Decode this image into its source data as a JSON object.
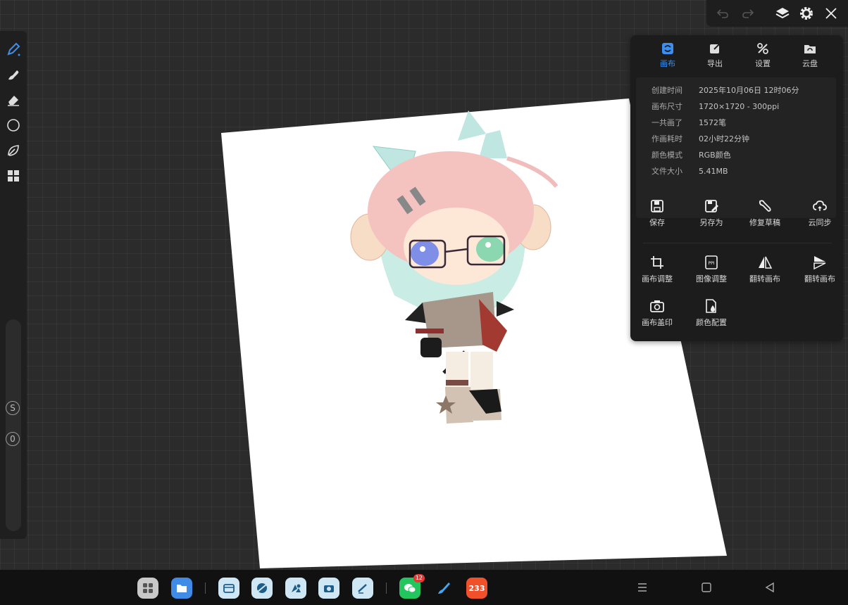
{
  "top_controls": {
    "undo_icon": "undo-icon",
    "redo_icon": "redo-icon",
    "layers_icon": "layers-icon",
    "settings_icon": "gear-icon",
    "close_icon": "close-icon"
  },
  "left_toolbar": {
    "tools": [
      "pen-icon",
      "smudge-icon",
      "eraser-icon",
      "color-circle-icon",
      "leaf-icon",
      "grid-icon"
    ],
    "size_badge": "S",
    "opacity_badge": "0"
  },
  "panel": {
    "tabs": [
      {
        "label": "画布",
        "icon": "canvas-icon",
        "active": true
      },
      {
        "label": "导出",
        "icon": "export-icon",
        "active": false
      },
      {
        "label": "设置",
        "icon": "tools-icon",
        "active": false
      },
      {
        "label": "云盘",
        "icon": "cloud-folder-icon",
        "active": false
      }
    ],
    "info": [
      {
        "key": "创建时间",
        "value": "2025年10月06日 12时06分"
      },
      {
        "key": "画布尺寸",
        "value": "1720×1720 - 300ppi"
      },
      {
        "key": "一共画了",
        "value": "1572笔"
      },
      {
        "key": "作画耗时",
        "value": "02小时22分钟"
      },
      {
        "key": "颜色模式",
        "value": "RGB颜色"
      },
      {
        "key": "文件大小",
        "value": "5.41MB"
      }
    ],
    "actions_row1": [
      {
        "label": "保存",
        "icon": "save-icon"
      },
      {
        "label": "另存为",
        "icon": "save-as-icon"
      },
      {
        "label": "修复草稿",
        "icon": "wrench-icon"
      },
      {
        "label": "云同步",
        "icon": "cloud-sync-icon"
      }
    ],
    "actions_row2": [
      {
        "label": "画布调整",
        "icon": "crop-icon"
      },
      {
        "label": "图像调整",
        "icon": "ppi-icon"
      },
      {
        "label": "翻转画布",
        "icon": "flip-horizontal-icon"
      },
      {
        "label": "翻转画布",
        "icon": "flip-vertical-icon"
      }
    ],
    "actions_row3": [
      {
        "label": "画布盖印",
        "icon": "camera-icon"
      },
      {
        "label": "颜色配置",
        "icon": "color-profile-icon"
      }
    ]
  },
  "taskbar": {
    "apps": [
      "app-grid-icon",
      "files-icon",
      "file-manager-icon",
      "browser-icon",
      "gallery-icon",
      "camera-app-icon",
      "notes-icon",
      "wechat-icon",
      "paint-app-icon",
      "app-233-icon"
    ],
    "wechat_badge": "12",
    "app_233_label": "233",
    "nav": [
      "menu-icon",
      "home-icon",
      "back-icon"
    ]
  },
  "colors": {
    "accent": "#3b8ff0",
    "panel_bg": "#1c1c1c",
    "canvas_bg": "#ffffff"
  }
}
